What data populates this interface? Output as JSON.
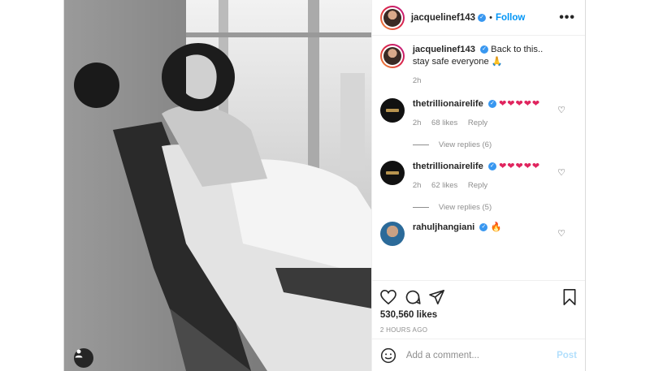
{
  "header": {
    "username": "jacquelinef143",
    "separator": "•",
    "follow_label": "Follow",
    "more_label": "•••"
  },
  "caption": {
    "username": "jacquelinef143",
    "text": "Back to this.. stay safe everyone 🙏",
    "time": "2h"
  },
  "comments": [
    {
      "username": "thetrillionairelife",
      "hearts": "❤❤❤❤❤",
      "time": "2h",
      "likes": "68 likes",
      "reply_label": "Reply",
      "view_replies": "View replies (6)"
    },
    {
      "username": "thetrillionairelife",
      "hearts": "❤❤❤❤❤",
      "time": "2h",
      "likes": "62 likes",
      "reply_label": "Reply",
      "view_replies": "View replies (5)"
    },
    {
      "username": "rahuljhangiani",
      "hearts": "🔥"
    }
  ],
  "like_count": "530,560 likes",
  "posted_ago": "2 HOURS AGO",
  "comment_box": {
    "placeholder": "Add a comment...",
    "post_label": "Post"
  }
}
